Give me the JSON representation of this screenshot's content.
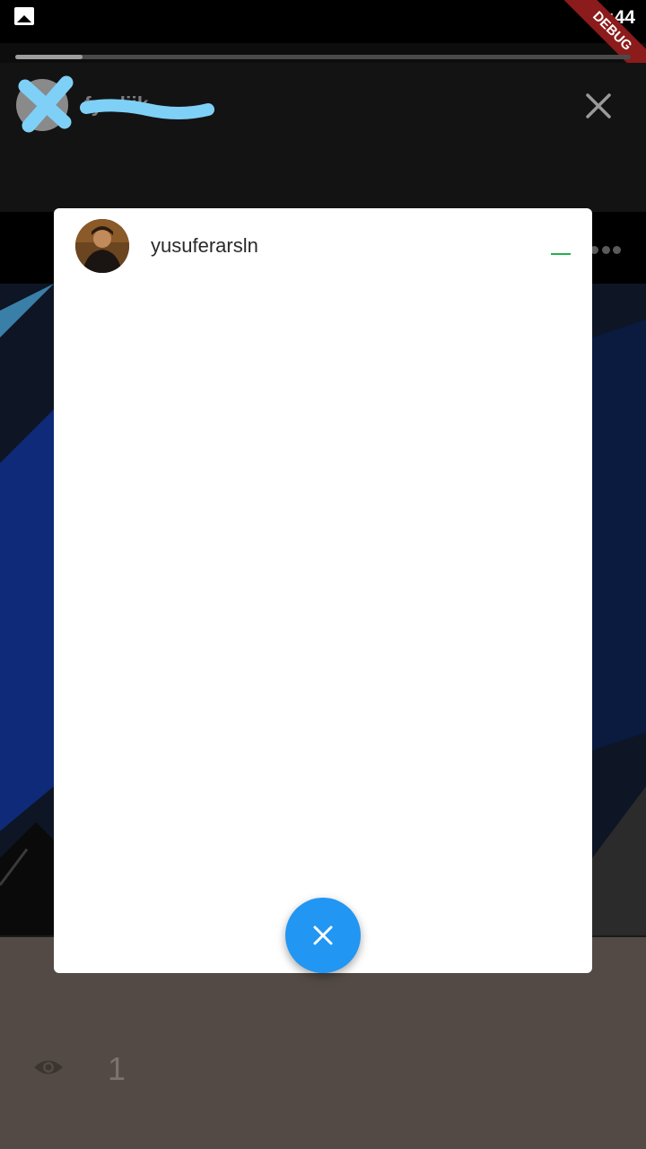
{
  "status_bar": {
    "time": "19:44",
    "debug_label": "DEBUG",
    "notification_icon": "gallery-icon"
  },
  "story": {
    "progress": 0.11,
    "username": "fy     eliik",
    "close_icon": "close-icon",
    "more_icon": "more-dots-icon",
    "view_icon": "eye-icon",
    "view_count": "1"
  },
  "viewers_sheet": {
    "viewers": [
      {
        "username": "yusuferarsln",
        "avatar": "avatar"
      }
    ],
    "indicator_color": "#22b24c",
    "close_button_icon": "close-icon",
    "accent_color": "#2196f3"
  },
  "colors": {
    "scribble": "#7fd0f7",
    "debug_banner": "#8c1b1b"
  }
}
